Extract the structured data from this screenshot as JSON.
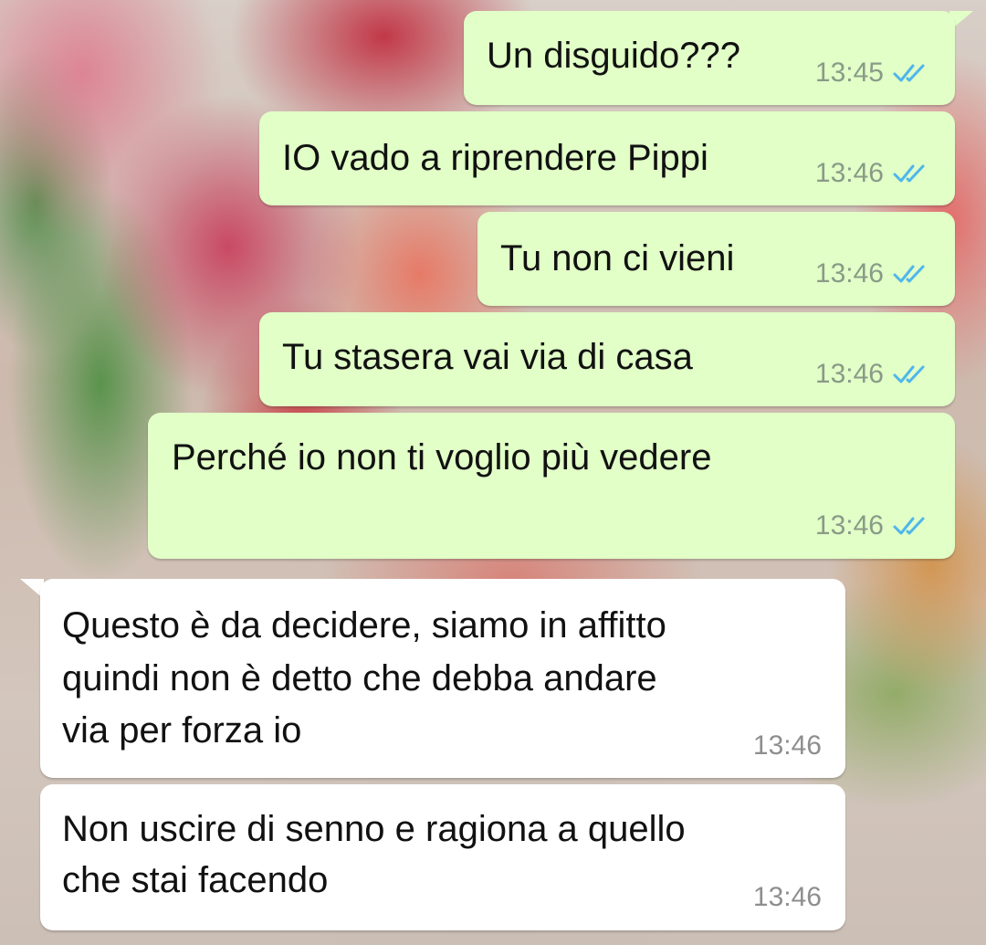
{
  "colors": {
    "outgoing_bubble": "#e1ffc7",
    "incoming_bubble": "#ffffff",
    "read_ticks": "#4fb6ec"
  },
  "messages": [
    {
      "direction": "outgoing",
      "text": "Un disguido???",
      "time": "13:45",
      "status_icon": "double-check-read-icon"
    },
    {
      "direction": "outgoing",
      "text": "IO vado a riprendere Pippi",
      "time": "13:46",
      "status_icon": "double-check-read-icon"
    },
    {
      "direction": "outgoing",
      "text": "Tu non ci vieni",
      "time": "13:46",
      "status_icon": "double-check-read-icon"
    },
    {
      "direction": "outgoing",
      "text": "Tu stasera vai via di casa",
      "time": "13:46",
      "status_icon": "double-check-read-icon"
    },
    {
      "direction": "outgoing",
      "text": "Perché io non ti voglio più vedere",
      "time": "13:46",
      "status_icon": "double-check-read-icon"
    },
    {
      "direction": "incoming",
      "lines": [
        "Questo è da decidere, siamo in affitto",
        "quindi non è detto che debba andare",
        "via per forza io"
      ],
      "time": "13:46"
    },
    {
      "direction": "incoming",
      "lines": [
        "Non uscire di senno e ragiona a quello",
        "che stai facendo"
      ],
      "time": "13:46"
    }
  ]
}
